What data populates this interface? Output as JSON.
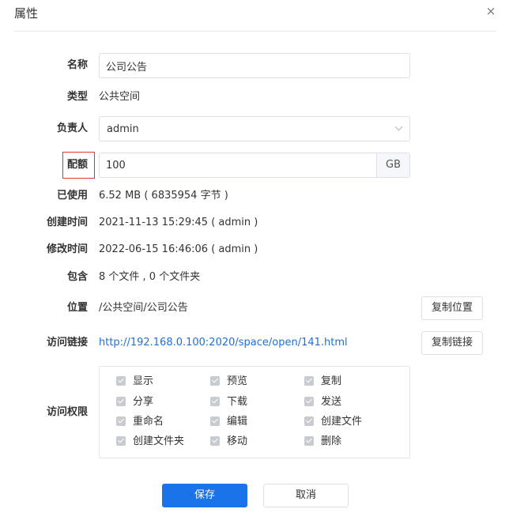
{
  "dialog": {
    "title": "属性",
    "close_glyph": "×"
  },
  "fields": {
    "name_label": "名称",
    "name_value": "公司公告",
    "type_label": "类型",
    "type_value": "公共空间",
    "owner_label": "负责人",
    "owner_value": "admin",
    "quota_label": "配额",
    "quota_value": "100",
    "quota_unit": "GB",
    "used_label": "已使用",
    "used_value": "6.52 MB ( 6835954 字节 )",
    "created_label": "创建时间",
    "created_value": "2021-11-13 15:29:45 ( admin )",
    "modified_label": "修改时间",
    "modified_value": "2022-06-15 16:46:06 ( admin )",
    "contains_label": "包含",
    "contains_value": "8 个文件 , 0 个文件夹",
    "location_label": "位置",
    "location_value": "/公共空间/公司公告",
    "copy_location_label": "复制位置",
    "link_label": "访问链接",
    "link_value": "http://192.168.0.100:2020/space/open/141.html",
    "copy_link_label": "复制链接",
    "perm_label": "访问权限"
  },
  "permissions": [
    {
      "label": "显示",
      "checked": true
    },
    {
      "label": "预览",
      "checked": true
    },
    {
      "label": "复制",
      "checked": true
    },
    {
      "label": "分享",
      "checked": true
    },
    {
      "label": "下载",
      "checked": true
    },
    {
      "label": "发送",
      "checked": true
    },
    {
      "label": "重命名",
      "checked": true
    },
    {
      "label": "编辑",
      "checked": true
    },
    {
      "label": "创建文件",
      "checked": true
    },
    {
      "label": "创建文件夹",
      "checked": true
    },
    {
      "label": "移动",
      "checked": true
    },
    {
      "label": "删除",
      "checked": true
    }
  ],
  "footer": {
    "save_label": "保存",
    "cancel_label": "取消"
  },
  "colors": {
    "primary": "#1a73e8",
    "link": "#1f6fd6",
    "highlight": "#e03030"
  },
  "icons": {
    "close": "close-icon",
    "dropdown": "chevron-down-icon",
    "checkbox": "checkmark-icon"
  }
}
